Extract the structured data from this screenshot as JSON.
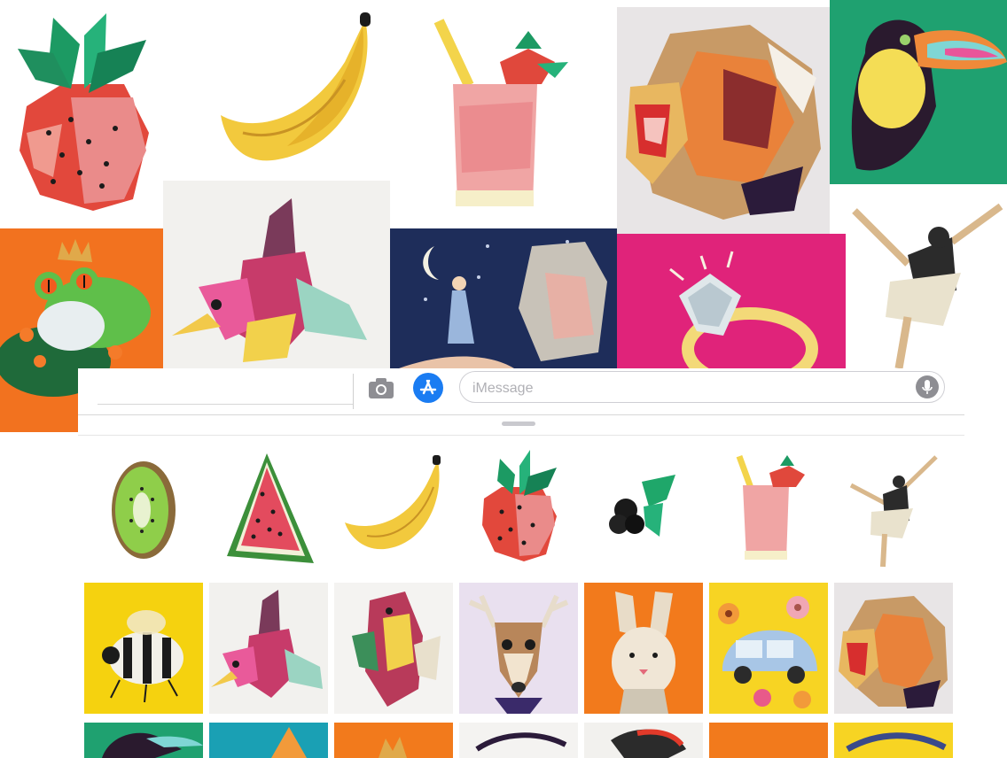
{
  "composer": {
    "placeholder": "iMessage"
  },
  "icons": {
    "camera": "camera-icon",
    "app_store": "app-store-icon",
    "microphone": "microphone-icon"
  },
  "colors": {
    "app_store_blue": "#1a7cf2",
    "field_border": "#cfcfd4"
  },
  "collage_tiles": [
    "strawberry",
    "banana",
    "pink-drink",
    "lion",
    "toucan",
    "frog-prince",
    "hummingbird",
    "night-sky-portrait",
    "diamond-ring",
    "ballerina"
  ],
  "stickers": [
    "kiwi",
    "watermelon",
    "banana",
    "strawberry",
    "blackberries",
    "pink-drink",
    "ballerina"
  ],
  "gallery": [
    "bee",
    "hummingbird",
    "parrot",
    "deer",
    "rabbit",
    "car-with-flowers",
    "lion"
  ]
}
